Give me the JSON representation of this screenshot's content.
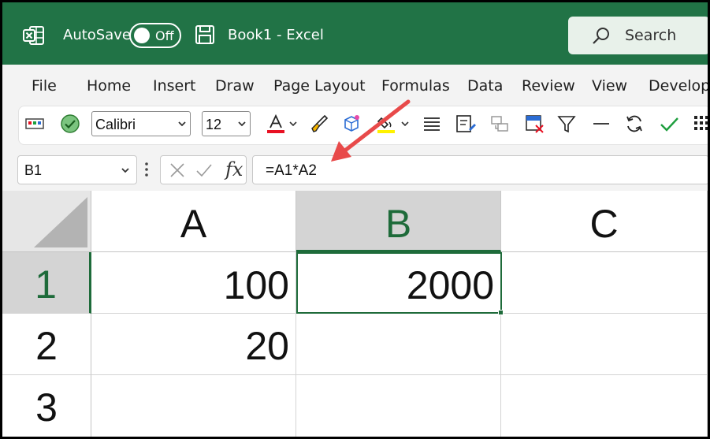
{
  "titlebar": {
    "autosave_label": "AutoSave",
    "autosave_state": "Off",
    "title": "Book1  -  Excel",
    "search_placeholder": "Search"
  },
  "menu": {
    "items": [
      "File",
      "Home",
      "Insert",
      "Draw",
      "Page Layout",
      "Formulas",
      "Data",
      "Review",
      "View",
      "Develop"
    ]
  },
  "ribbon": {
    "font_name": "Calibri",
    "font_size": "12",
    "colors": {
      "font_color": "#e81123",
      "highlight": "#fff200",
      "accept": "#1e9e3e"
    }
  },
  "formulabar": {
    "name_box": "B1",
    "fx_label": "fx",
    "formula": "=A1*A2"
  },
  "grid": {
    "columns": [
      "A",
      "B",
      "C"
    ],
    "selected_column": "B",
    "rows": [
      "1",
      "2",
      "3"
    ],
    "selected_row": "1",
    "cells": {
      "A1": "100",
      "B1": "2000",
      "A2": "20"
    }
  },
  "colors": {
    "titlebar": "#217346",
    "selection": "#1e6b3a",
    "annotation_arrow": "#e84a4a"
  }
}
